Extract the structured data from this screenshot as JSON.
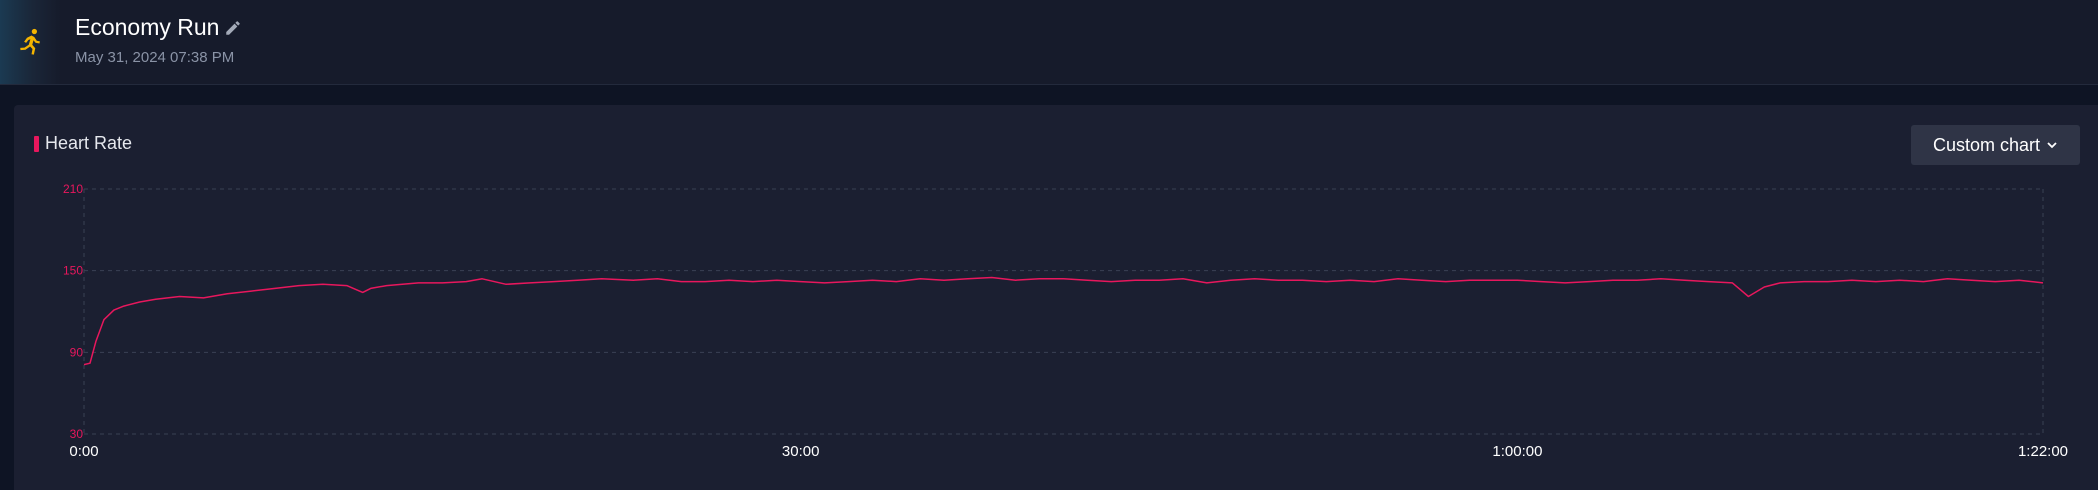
{
  "header": {
    "title": "Economy Run",
    "date": "May 31, 2024 07:38 PM",
    "activity_icon": "running-person-icon",
    "edit_icon": "pencil-icon"
  },
  "chart_panel": {
    "label": "Heart Rate",
    "custom_chart_label": "Custom chart",
    "dropdown_icon": "chevron-down-icon"
  },
  "colors": {
    "accent": "#e8175d",
    "activity_icon": "#f4b400",
    "background": "#0e1424",
    "panel": "#1b1f31"
  },
  "chart_data": {
    "type": "line",
    "title": "Heart Rate",
    "xlabel": "",
    "ylabel": "",
    "ylim": [
      30,
      210
    ],
    "xlim": [
      0,
      4920
    ],
    "yticks": [
      210,
      150,
      90,
      30
    ],
    "xtick_labels": [
      {
        "value": 0,
        "label": "0:00"
      },
      {
        "value": 1800,
        "label": "30:00"
      },
      {
        "value": 3600,
        "label": "1:00:00"
      },
      {
        "value": 4920,
        "label": "1:22:00"
      }
    ],
    "grid": true,
    "series": [
      {
        "x": [
          0,
          15,
          30,
          50,
          75,
          100,
          140,
          180,
          240,
          300,
          360,
          420,
          480,
          540,
          600,
          660,
          700,
          720,
          760,
          800,
          840,
          900,
          960,
          1000,
          1060,
          1120,
          1180,
          1240,
          1300,
          1380,
          1440,
          1500,
          1560,
          1620,
          1680,
          1740,
          1800,
          1860,
          1920,
          1980,
          2040,
          2100,
          2160,
          2220,
          2280,
          2340,
          2400,
          2460,
          2520,
          2580,
          2640,
          2700,
          2760,
          2820,
          2880,
          2940,
          3000,
          3060,
          3120,
          3180,
          3240,
          3300,
          3360,
          3420,
          3480,
          3540,
          3600,
          3660,
          3720,
          3780,
          3840,
          3900,
          3960,
          4020,
          4080,
          4140,
          4160,
          4180,
          4220,
          4260,
          4320,
          4380,
          4440,
          4500,
          4560,
          4620,
          4680,
          4740,
          4800,
          4860,
          4920
        ],
        "values": [
          81,
          82,
          98,
          114,
          121,
          124,
          127,
          129,
          131,
          130,
          133,
          135,
          137,
          139,
          140,
          139,
          134,
          137,
          139,
          140,
          141,
          141,
          142,
          144,
          140,
          141,
          142,
          143,
          144,
          143,
          144,
          142,
          142,
          143,
          142,
          143,
          142,
          141,
          142,
          143,
          142,
          144,
          143,
          144,
          145,
          143,
          144,
          144,
          143,
          142,
          143,
          143,
          144,
          141,
          143,
          144,
          143,
          143,
          142,
          143,
          142,
          144,
          143,
          142,
          143,
          143,
          143,
          142,
          141,
          142,
          143,
          143,
          144,
          143,
          142,
          141,
          136,
          131,
          138,
          141,
          142,
          142,
          143,
          142,
          143,
          142,
          144,
          143,
          142,
          143,
          141
        ]
      }
    ]
  }
}
